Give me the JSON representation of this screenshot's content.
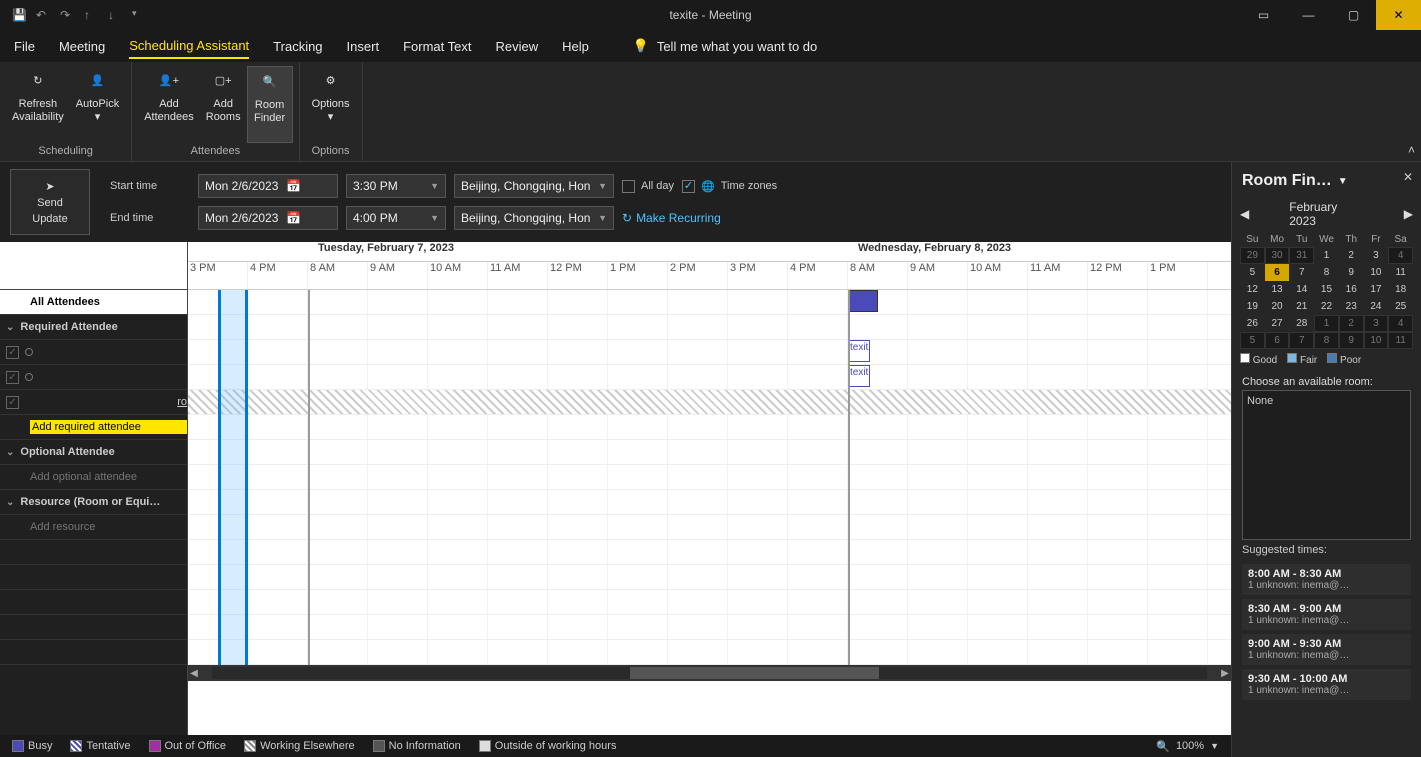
{
  "window": {
    "title": "texite  -  Meeting"
  },
  "menu": {
    "tabs": [
      "File",
      "Meeting",
      "Scheduling Assistant",
      "Tracking",
      "Insert",
      "Format Text",
      "Review",
      "Help"
    ],
    "active": "Scheduling Assistant",
    "tellme": "Tell me what you want to do"
  },
  "ribbon": {
    "groups": [
      {
        "label": "Scheduling",
        "buttons": [
          {
            "id": "refresh",
            "line1": "Refresh",
            "line2": "Availability"
          },
          {
            "id": "autopick",
            "line1": "AutoPick",
            "line2": "",
            "dd": true
          }
        ]
      },
      {
        "label": "Attendees",
        "buttons": [
          {
            "id": "add-attendees",
            "line1": "Add",
            "line2": "Attendees"
          },
          {
            "id": "add-rooms",
            "line1": "Add",
            "line2": "Rooms"
          },
          {
            "id": "room-finder",
            "line1": "Room",
            "line2": "Finder",
            "active": true
          }
        ]
      },
      {
        "label": "Options",
        "buttons": [
          {
            "id": "options",
            "line1": "Options",
            "line2": "",
            "dd": true
          }
        ]
      }
    ]
  },
  "send": {
    "label1": "Send",
    "label2": "Update"
  },
  "times": {
    "start_label": "Start time",
    "end_label": "End time",
    "start_date": "Mon 2/6/2023",
    "start_time": "3:30 PM",
    "end_date": "Mon 2/6/2023",
    "end_time": "4:00 PM",
    "tz": "Beijing, Chongqing, Hon",
    "allday": "All day",
    "timezones": "Time zones",
    "recurring": "Make Recurring"
  },
  "attendees": {
    "header_all": "All Attendees",
    "required": "Required Attendee",
    "add_required": "Add required attendee",
    "optional": "Optional Attendee",
    "add_optional": "Add optional attendee",
    "resource": "Resource (Room or Equi…",
    "add_resource": "Add resource",
    "row3_text": "ro"
  },
  "grid": {
    "dates": [
      "Tuesday, February 7, 2023",
      "Wednesday, February 8, 2023"
    ],
    "hours": [
      "3 PM",
      "4 PM",
      "8 AM",
      "9 AM",
      "10 AM",
      "11 AM",
      "12 PM",
      "1 PM",
      "2 PM",
      "3 PM",
      "4 PM",
      "8 AM",
      "9 AM",
      "10 AM",
      "11 AM",
      "12 PM",
      "1 PM"
    ],
    "event_label": "texit"
  },
  "legend": {
    "items": [
      "Busy",
      "Tentative",
      "Out of Office",
      "Working Elsewhere",
      "No Information",
      "Outside of working hours"
    ],
    "zoom": "100%"
  },
  "roomfinder": {
    "title": "Room Fin…",
    "month": "February 2023",
    "dow": [
      "Su",
      "Mo",
      "Tu",
      "We",
      "Th",
      "Fr",
      "Sa"
    ],
    "weeks": [
      [
        {
          "d": "29",
          "t": "prev"
        },
        {
          "d": "30",
          "t": "prev"
        },
        {
          "d": "31",
          "t": "prev"
        },
        {
          "d": "1"
        },
        {
          "d": "2"
        },
        {
          "d": "3"
        },
        {
          "d": "4",
          "t": "next"
        }
      ],
      [
        {
          "d": "5"
        },
        {
          "d": "6",
          "t": "today"
        },
        {
          "d": "7"
        },
        {
          "d": "8"
        },
        {
          "d": "9"
        },
        {
          "d": "10"
        },
        {
          "d": "11"
        }
      ],
      [
        {
          "d": "12"
        },
        {
          "d": "13"
        },
        {
          "d": "14"
        },
        {
          "d": "15"
        },
        {
          "d": "16"
        },
        {
          "d": "17"
        },
        {
          "d": "18"
        }
      ],
      [
        {
          "d": "19"
        },
        {
          "d": "20"
        },
        {
          "d": "21"
        },
        {
          "d": "22"
        },
        {
          "d": "23"
        },
        {
          "d": "24"
        },
        {
          "d": "25"
        }
      ],
      [
        {
          "d": "26"
        },
        {
          "d": "27"
        },
        {
          "d": "28"
        },
        {
          "d": "1",
          "t": "next"
        },
        {
          "d": "2",
          "t": "next"
        },
        {
          "d": "3",
          "t": "next"
        },
        {
          "d": "4",
          "t": "next"
        }
      ],
      [
        {
          "d": "5",
          "t": "next"
        },
        {
          "d": "6",
          "t": "next"
        },
        {
          "d": "7",
          "t": "next"
        },
        {
          "d": "8",
          "t": "next"
        },
        {
          "d": "9",
          "t": "next"
        },
        {
          "d": "10",
          "t": "next"
        },
        {
          "d": "11",
          "t": "next"
        }
      ]
    ],
    "cal_legend": [
      "Good",
      "Fair",
      "Poor"
    ],
    "choose_label": "Choose an available room:",
    "room_none": "None",
    "sugg_label": "Suggested times:",
    "slots": [
      {
        "t": "8:00 AM - 8:30 AM",
        "s": "1 unknown: inema@…"
      },
      {
        "t": "8:30 AM - 9:00 AM",
        "s": "1 unknown: inema@…"
      },
      {
        "t": "9:00 AM - 9:30 AM",
        "s": "1 unknown: inema@…"
      },
      {
        "t": "9:30 AM - 10:00 AM",
        "s": "1 unknown: inema@…"
      }
    ]
  }
}
